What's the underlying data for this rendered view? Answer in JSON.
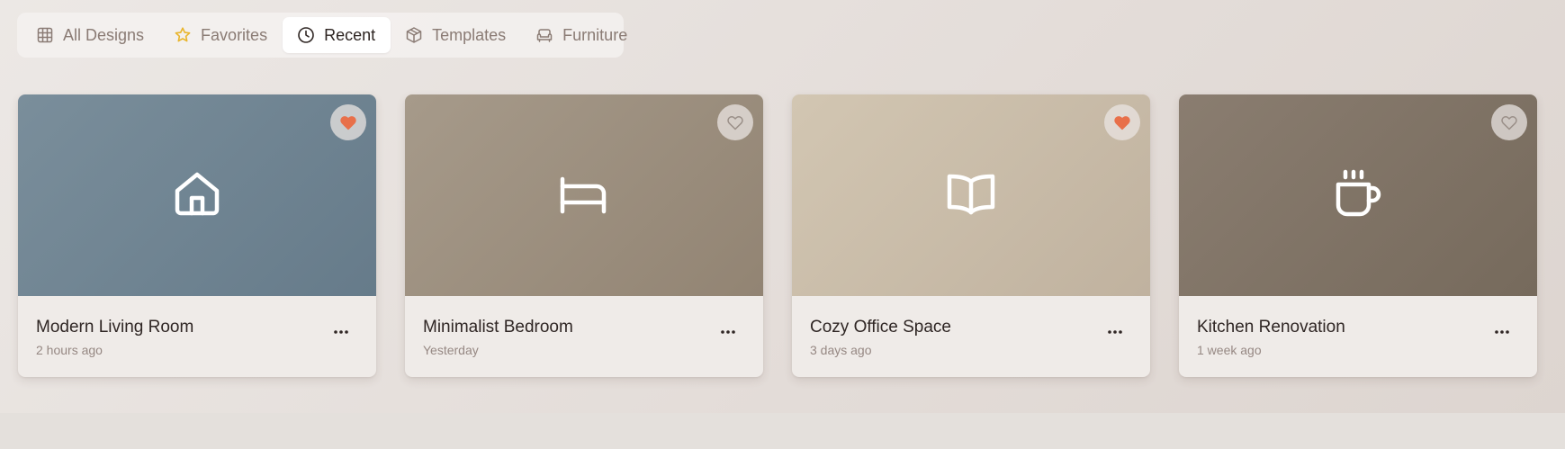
{
  "tabs": [
    {
      "label": "All Designs",
      "icon": "grid-icon",
      "active": false
    },
    {
      "label": "Favorites",
      "icon": "star-icon",
      "active": false
    },
    {
      "label": "Recent",
      "icon": "clock-icon",
      "active": true
    },
    {
      "label": "Templates",
      "icon": "box-icon",
      "active": false
    },
    {
      "label": "Furniture",
      "icon": "sofa-icon",
      "active": false
    }
  ],
  "cards": [
    {
      "title": "Modern Living Room",
      "time": "2 hours ago",
      "icon": "home-icon",
      "favorite": true,
      "gradient": [
        "#7a8e9b",
        "#667b8a"
      ]
    },
    {
      "title": "Minimalist Bedroom",
      "time": "Yesterday",
      "icon": "bed-icon",
      "favorite": false,
      "gradient": [
        "#a69a8a",
        "#928473"
      ]
    },
    {
      "title": "Cozy Office Space",
      "time": "3 days ago",
      "icon": "book-icon",
      "favorite": true,
      "gradient": [
        "#d2c6b2",
        "#c0b29f"
      ]
    },
    {
      "title": "Kitchen Renovation",
      "time": "1 week ago",
      "icon": "coffee-icon",
      "favorite": false,
      "gradient": [
        "#8a7d70",
        "#766a5c"
      ]
    }
  ],
  "colors": {
    "favorite_active": "#e8704a",
    "favorite_inactive": "#9a8f88",
    "star": "#e9b52c"
  }
}
